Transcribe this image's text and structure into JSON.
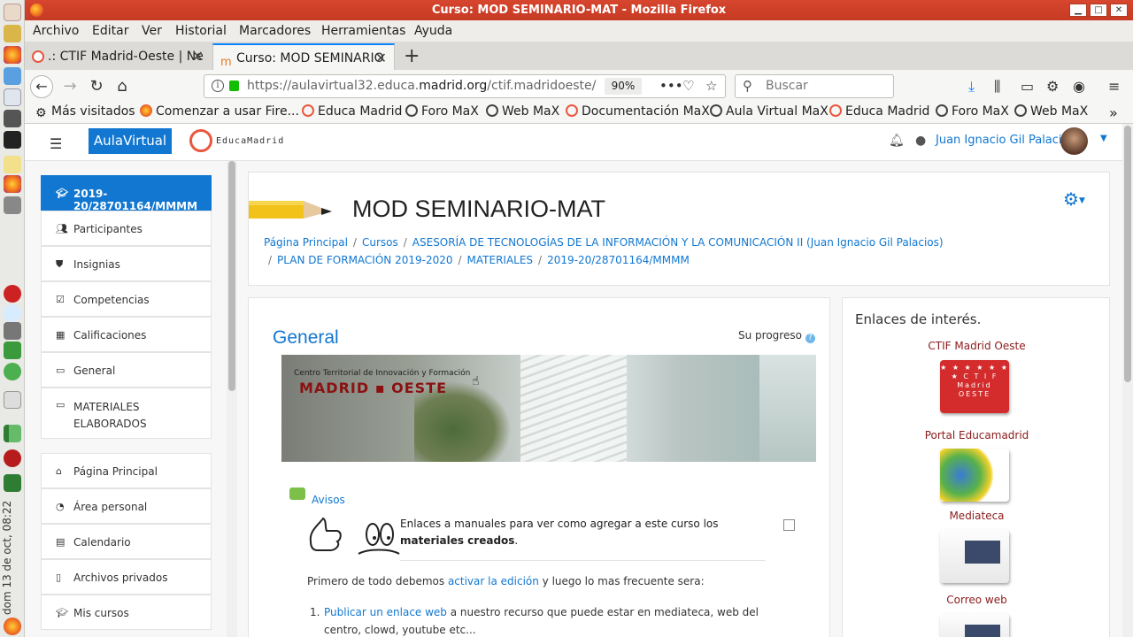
{
  "window": {
    "title": "Curso: MOD SEMINARIO-MAT - Mozilla Firefox"
  },
  "menu": [
    "Archivo",
    "Editar",
    "Ver",
    "Historial",
    "Marcadores",
    "Herramientas",
    "Ayuda"
  ],
  "tabs": [
    {
      "label": ".: CTIF Madrid-Oeste | Ne"
    },
    {
      "label": "Curso: MOD SEMINARIO"
    }
  ],
  "nav": {
    "url_prefix": "https://aulavirtual32.educa.",
    "url_domain": "madrid.org",
    "url_suffix": "/ctif.madridoeste/",
    "zoom": "90%",
    "search_placeholder": "Buscar"
  },
  "bookmarks": [
    "Más visitados",
    "Comenzar a usar Fire...",
    "Educa Madrid",
    "Foro MaX",
    "Web MaX",
    "Documentación MaX",
    "Aula Virtual MaX",
    "Educa Madrid",
    "Foro MaX",
    "Web MaX"
  ],
  "system": {
    "clock": "dom 13 de oct, 08:22"
  },
  "topnav": {
    "brand_button": "AulaVirtual",
    "edu_text": "EducaMadrid",
    "username": "Juan Ignacio Gil Palacios"
  },
  "sidebar": {
    "items": [
      {
        "label": "2019-20/28701164/MMMM",
        "icon": "graduation-cap"
      },
      {
        "label": "Participantes",
        "icon": "users"
      },
      {
        "label": "Insignias",
        "icon": "shield"
      },
      {
        "label": "Competencias",
        "icon": "check-square"
      },
      {
        "label": "Calificaciones",
        "icon": "table"
      },
      {
        "label": "General",
        "icon": "folder"
      },
      {
        "label": "MATERIALES ELABORADOS",
        "icon": "folder"
      }
    ],
    "items2": [
      {
        "label": "Página Principal",
        "icon": "home"
      },
      {
        "label": "Área personal",
        "icon": "dashboard"
      },
      {
        "label": "Calendario",
        "icon": "calendar"
      },
      {
        "label": "Archivos privados",
        "icon": "file"
      },
      {
        "label": "Mis cursos",
        "icon": "graduation-cap"
      }
    ]
  },
  "course": {
    "title": "MOD SEMINARIO-MAT",
    "breadcrumbs_line1": [
      "Página Principal",
      "Cursos",
      "ASESORÍA DE TECNOLOGÍAS DE LA INFORMACIÓN Y LA COMUNICACIÓN II (Juan Ignacio Gil Palacios)"
    ],
    "breadcrumbs_line2": [
      "PLAN DE FORMACIÓN 2019-2020",
      "MATERIALES",
      "2019-20/28701164/MMMM"
    ]
  },
  "section": {
    "title": "General",
    "progress_label": "Su progreso",
    "banner_small": "Centro Territorial de Innovación y Formación",
    "banner_big": "MADRID ▪ OESTE",
    "avisos": "Avisos",
    "desc_text": "Enlaces a manuales para ver como agregar a este curso los ",
    "desc_bold": "materiales creados",
    "desc_end": ".",
    "p1_start": "Primero de todo debemos ",
    "p1_link": "activar la edición",
    "p1_end": " y luego lo mas frecuente sera:",
    "li1_num": "1.",
    "li1_link": "Publicar un enlace web",
    "li1_text": " a nuestro recurso que puede estar en mediateca, web del centro, clowd, youtube etc..."
  },
  "right": {
    "title": "Enlaces de interés.",
    "links": [
      "CTIF Madrid Oeste",
      "Portal Educamadrid",
      "Mediateca",
      "Correo web"
    ],
    "ctif_logo_text": "★ ★ ★ ★ ★ ★ ★ C T I F Madrid OESTE"
  },
  "colors": {
    "accent": "#1177d1",
    "titlebar": "#c63a23",
    "link_red": "#8b1a1a"
  }
}
